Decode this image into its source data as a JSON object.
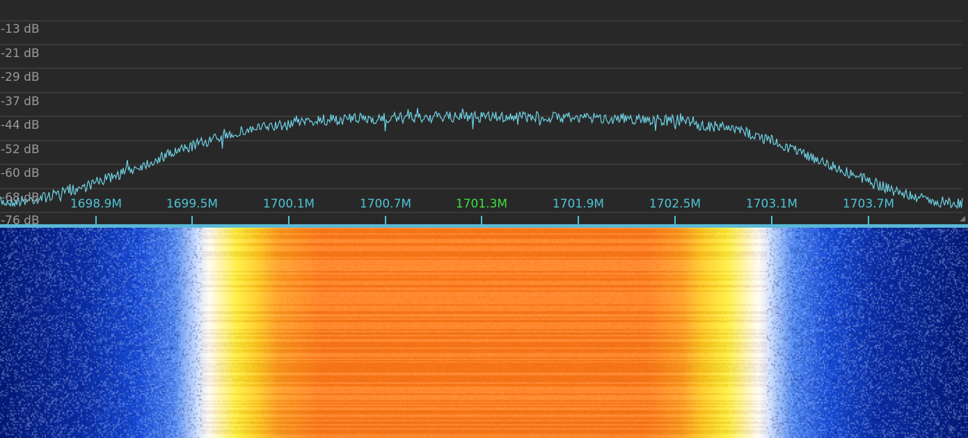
{
  "db_scale": {
    "labels": [
      "-13 dB",
      "-21 dB",
      "-29 dB",
      "-37 dB",
      "-44 dB",
      "-52 dB",
      "-60 dB",
      "-68 dB",
      "-76 dB"
    ]
  },
  "frequency_axis": {
    "labels": [
      "1698.9M",
      "1699.5M",
      "1700.1M",
      "1700.7M",
      "1701.3M",
      "1701.9M",
      "1702.5M",
      "1703.1M",
      "1703.7M"
    ],
    "center_label": "1701.3M"
  },
  "colors": {
    "trace": "#6fd3e6",
    "grid": "#4a4a4a",
    "freq_label": "#4fc3d6",
    "center_label": "#3ee03e",
    "axis_bar": "#5ab8d6",
    "waterfall_low": "#0a1e8c",
    "waterfall_mid": "#ffffff",
    "waterfall_high": "#ff7a1a"
  }
}
